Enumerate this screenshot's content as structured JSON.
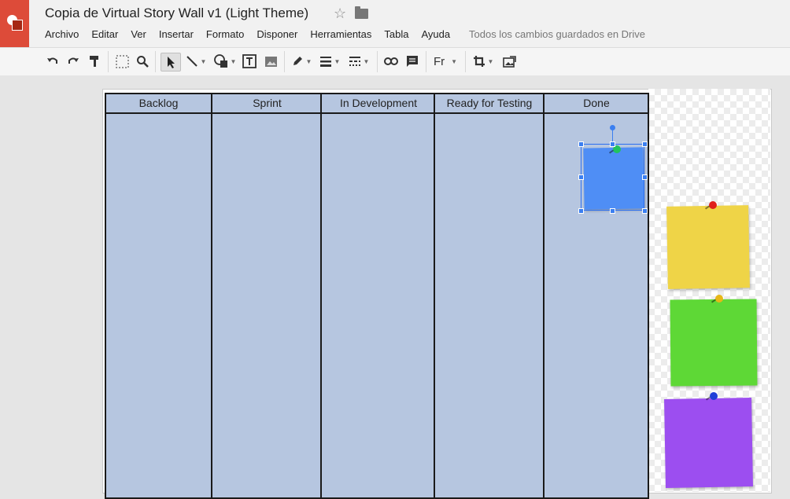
{
  "app": {
    "title": "Copia de Virtual Story Wall v1 (Light Theme)",
    "saved_status": "Todos los cambios guardados en Drive"
  },
  "menu": [
    "Archivo",
    "Editar",
    "Ver",
    "Insertar",
    "Formato",
    "Disponer",
    "Herramientas",
    "Tabla",
    "Ayuda"
  ],
  "toolbar": {
    "font_label": "Fr"
  },
  "board": {
    "columns": [
      "Backlog",
      "Sprint",
      "In Development",
      "Ready for Testing",
      "Done"
    ]
  },
  "colors": {
    "board_bg": "#b6c6e0",
    "note_blue": "#4f8ef5",
    "note_yellow": "#efd447",
    "note_green": "#5ed836",
    "note_purple": "#9c4ef0",
    "logo_red": "#dd4b39"
  },
  "icons": [
    "undo-icon",
    "redo-icon",
    "paint-format-icon",
    "fit-icon",
    "zoom-icon",
    "select-icon",
    "line-icon",
    "shape-icon",
    "textbox-icon",
    "image-icon",
    "pen-color-icon",
    "line-weight-icon",
    "line-dash-icon",
    "link-icon",
    "comment-icon",
    "crop-icon",
    "replace-image-icon"
  ]
}
